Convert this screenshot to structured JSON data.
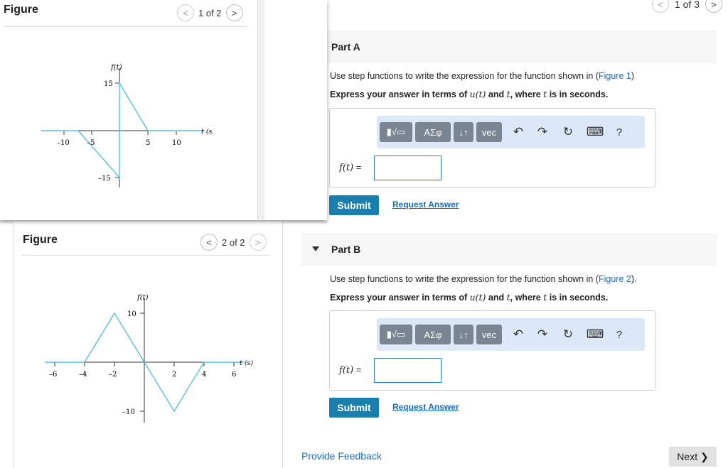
{
  "pager_top": {
    "text": "1 of 3",
    "prev": "<",
    "next": ">"
  },
  "part_a": {
    "title": "Part A",
    "instruction_prefix": "Use step functions to write the expression for the function shown in (",
    "instruction_link": "Figure 1",
    "instruction_suffix": ")",
    "express": "Express your answer in terms of ",
    "express_u": "u(t)",
    "express_mid": " and ",
    "express_t": "t",
    "express_end": ", where ",
    "express_t2": "t",
    "express_tail": " is in seconds.",
    "field_label": "f(t)",
    "field_eq": " =",
    "input_value": "",
    "submit": "Submit",
    "request": "Request Answer"
  },
  "part_b": {
    "title": "Part B",
    "instruction_prefix": "Use step functions to write the expression for the function shown in (",
    "instruction_link": "Figure 2",
    "instruction_suffix": ").",
    "express": "Express your answer in terms of ",
    "express_u": "u(t)",
    "express_mid": " and ",
    "express_t": "t",
    "express_end": ", where ",
    "express_t2": "t",
    "express_tail": " is in seconds.",
    "field_label": "f(t)",
    "field_eq": " =",
    "input_value": "",
    "submit": "Submit",
    "request": "Request Answer"
  },
  "toolbar": {
    "templates": "▮√▭",
    "greek": "ΑΣφ",
    "arrows": "↓↑",
    "vec": "vec",
    "undo": "↶",
    "redo": "↷",
    "reset": "↻",
    "keyboard": "⌨",
    "help": "?"
  },
  "footer": {
    "feedback": "Provide Feedback",
    "next": "Next ❯"
  },
  "figure1": {
    "title": "Figure",
    "pager": "1 of 2",
    "ylabel": "f(t)",
    "xlabel": "t (s)",
    "ticks": {
      "y_pos": "15",
      "y_neg": "–15",
      "x_m10": "–10",
      "x_m5": "–5",
      "x_5": "5",
      "x_10": "10"
    }
  },
  "figure2": {
    "title": "Figure",
    "pager": "2 of 2",
    "ylabel": "f(t)",
    "xlabel": "t (s)",
    "ticks": {
      "y_pos": "10",
      "y_neg": "–10",
      "x_m6": "–6",
      "x_m4": "–4",
      "x_m2": "–2",
      "x_2": "2",
      "x_4": "4",
      "x_6": "6"
    }
  },
  "colors": {
    "curve": "#5bbde0",
    "link": "#1a6bbf",
    "submit": "#1b7fad"
  }
}
